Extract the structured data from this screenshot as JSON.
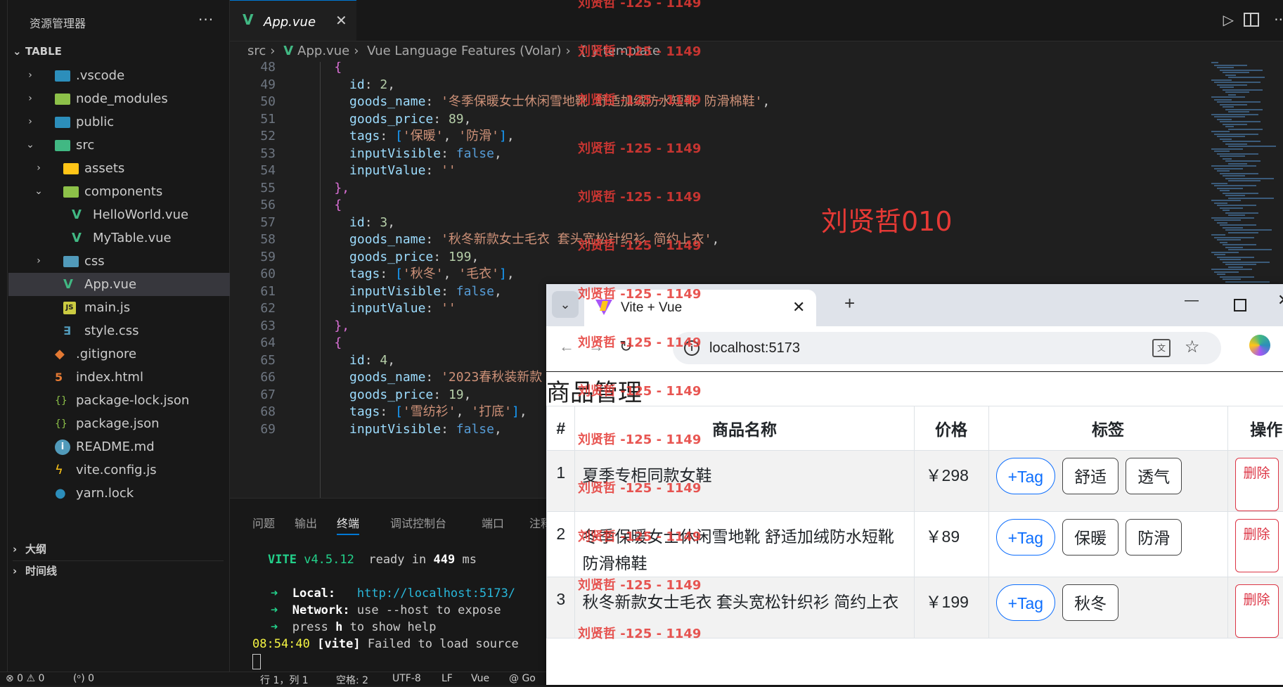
{
  "sidebar": {
    "title": "资源管理器",
    "more": "···",
    "root": "TABLE",
    "outline": "大纲",
    "timeline": "时间线",
    "items": [
      {
        "label": ".vscode",
        "icon": "vscode-folder-icon"
      },
      {
        "label": "node_modules",
        "icon": "node-folder-icon"
      },
      {
        "label": "public",
        "icon": "public-folder-icon"
      },
      {
        "label": "src",
        "icon": "src-folder-icon"
      },
      {
        "label": "assets",
        "icon": "assets-folder-icon"
      },
      {
        "label": "components",
        "icon": "components-folder-icon"
      },
      {
        "label": "HelloWorld.vue",
        "icon": "vue-file-icon"
      },
      {
        "label": "MyTable.vue",
        "icon": "vue-file-icon"
      },
      {
        "label": "css",
        "icon": "css-folder-icon"
      },
      {
        "label": "App.vue",
        "icon": "vue-file-icon"
      },
      {
        "label": "main.js",
        "icon": "js-file-icon"
      },
      {
        "label": "style.css",
        "icon": "css-file-icon"
      },
      {
        "label": ".gitignore",
        "icon": "git-file-icon"
      },
      {
        "label": "index.html",
        "icon": "html-file-icon"
      },
      {
        "label": "package-lock.json",
        "icon": "json-file-icon"
      },
      {
        "label": "package.json",
        "icon": "json-file-icon"
      },
      {
        "label": "README.md",
        "icon": "info-file-icon"
      },
      {
        "label": "vite.config.js",
        "icon": "vite-file-icon"
      },
      {
        "label": "yarn.lock",
        "icon": "yarn-file-icon"
      }
    ]
  },
  "editor": {
    "tab_label": "App.vue",
    "breadcrumb": [
      "src",
      "App.vue",
      "Vue Language Features (Volar)",
      "{ } template"
    ],
    "lines": [
      {
        "n": "48",
        "code": "{"
      },
      {
        "n": "49",
        "code": "  id: 2,"
      },
      {
        "n": "50",
        "code": "  goods_name: '冬季保暖女士休闲雪地靴 舒适加绒防水短靴 防滑棉鞋',"
      },
      {
        "n": "51",
        "code": "  goods_price: 89,"
      },
      {
        "n": "52",
        "code": "  tags: ['保暖', '防滑'],"
      },
      {
        "n": "53",
        "code": "  inputVisible: false,"
      },
      {
        "n": "54",
        "code": "  inputValue: ''"
      },
      {
        "n": "55",
        "code": "},"
      },
      {
        "n": "56",
        "code": "{"
      },
      {
        "n": "57",
        "code": "  id: 3,"
      },
      {
        "n": "58",
        "code": "  goods_name: '秋冬新款女士毛衣 套头宽松针织衫 简约上衣',"
      },
      {
        "n": "59",
        "code": "  goods_price: 199,"
      },
      {
        "n": "60",
        "code": "  tags: ['秋冬', '毛衣'],"
      },
      {
        "n": "61",
        "code": "  inputVisible: false,"
      },
      {
        "n": "62",
        "code": "  inputValue: ''"
      },
      {
        "n": "63",
        "code": "},"
      },
      {
        "n": "64",
        "code": "{"
      },
      {
        "n": "65",
        "code": "  id: 4,"
      },
      {
        "n": "66",
        "code": "  goods_name: '2023春秋装新款"
      },
      {
        "n": "67",
        "code": "  goods_price: 19,"
      },
      {
        "n": "68",
        "code": "  tags: ['雪纺衫', '打底'],"
      },
      {
        "n": "69",
        "code": "  inputVisible: false,"
      }
    ]
  },
  "panel": {
    "tabs": [
      "问题",
      "输出",
      "终端",
      "调试控制台",
      "端口",
      "注释"
    ],
    "active_tab": "终端",
    "terminal": {
      "vite_name": "VITE",
      "vite_version": "v4.5.12",
      "ready_text": "ready in",
      "ready_ms": "449",
      "ms_unit": "ms",
      "arrow": "➜",
      "local_label": "Local:",
      "local_url": "http://localhost:5173/",
      "network_label": "Network:",
      "network_text": "use --host to expose",
      "press_text": "press",
      "press_key": "h",
      "help_text": "to show help",
      "time": "08:54:40",
      "vite_tag": "[vite]",
      "error_text": "Failed to load source"
    }
  },
  "statusbar": {
    "problems": "⊗ 0 ⚠ 0",
    "ports": "(ᵒ) 0",
    "position": "行 1，列 1",
    "spaces": "空格: 2",
    "encoding": "UTF-8",
    "eol": "LF",
    "language": "Vue",
    "go_live": "@ Go"
  },
  "browser": {
    "tab_title": "Vite + Vue",
    "url": "localhost:5173",
    "page_title": "商品管理",
    "columns": [
      "#",
      "商品名称",
      "价格",
      "标签",
      "操作"
    ],
    "add_tag_label": "+Tag",
    "delete_label": "删除",
    "rows": [
      {
        "idx": "1",
        "name": "夏季专柜同款女鞋",
        "price": "￥298",
        "tags": [
          "舒适",
          "透气"
        ]
      },
      {
        "idx": "2",
        "name": "冬季保暖女士休闲雪地靴 舒适加绒防水短靴 防滑棉鞋",
        "price": "￥89",
        "tags": [
          "保暖",
          "防滑"
        ]
      },
      {
        "idx": "3",
        "name": "秋冬新款女士毛衣 套头宽松针织衫 简约上衣",
        "price": "￥199",
        "tags": [
          "秋冬"
        ]
      }
    ]
  },
  "watermark": {
    "small": "刘贤哲 -125 - 1149",
    "big": "刘贤哲010"
  },
  "colors": {
    "vscode_bg": "#1f1f1f",
    "accent": "#0078d4",
    "vue_green": "#41b883",
    "watermark_red": "#e53935",
    "danger": "#dc3545",
    "primary": "#0d6efd"
  }
}
